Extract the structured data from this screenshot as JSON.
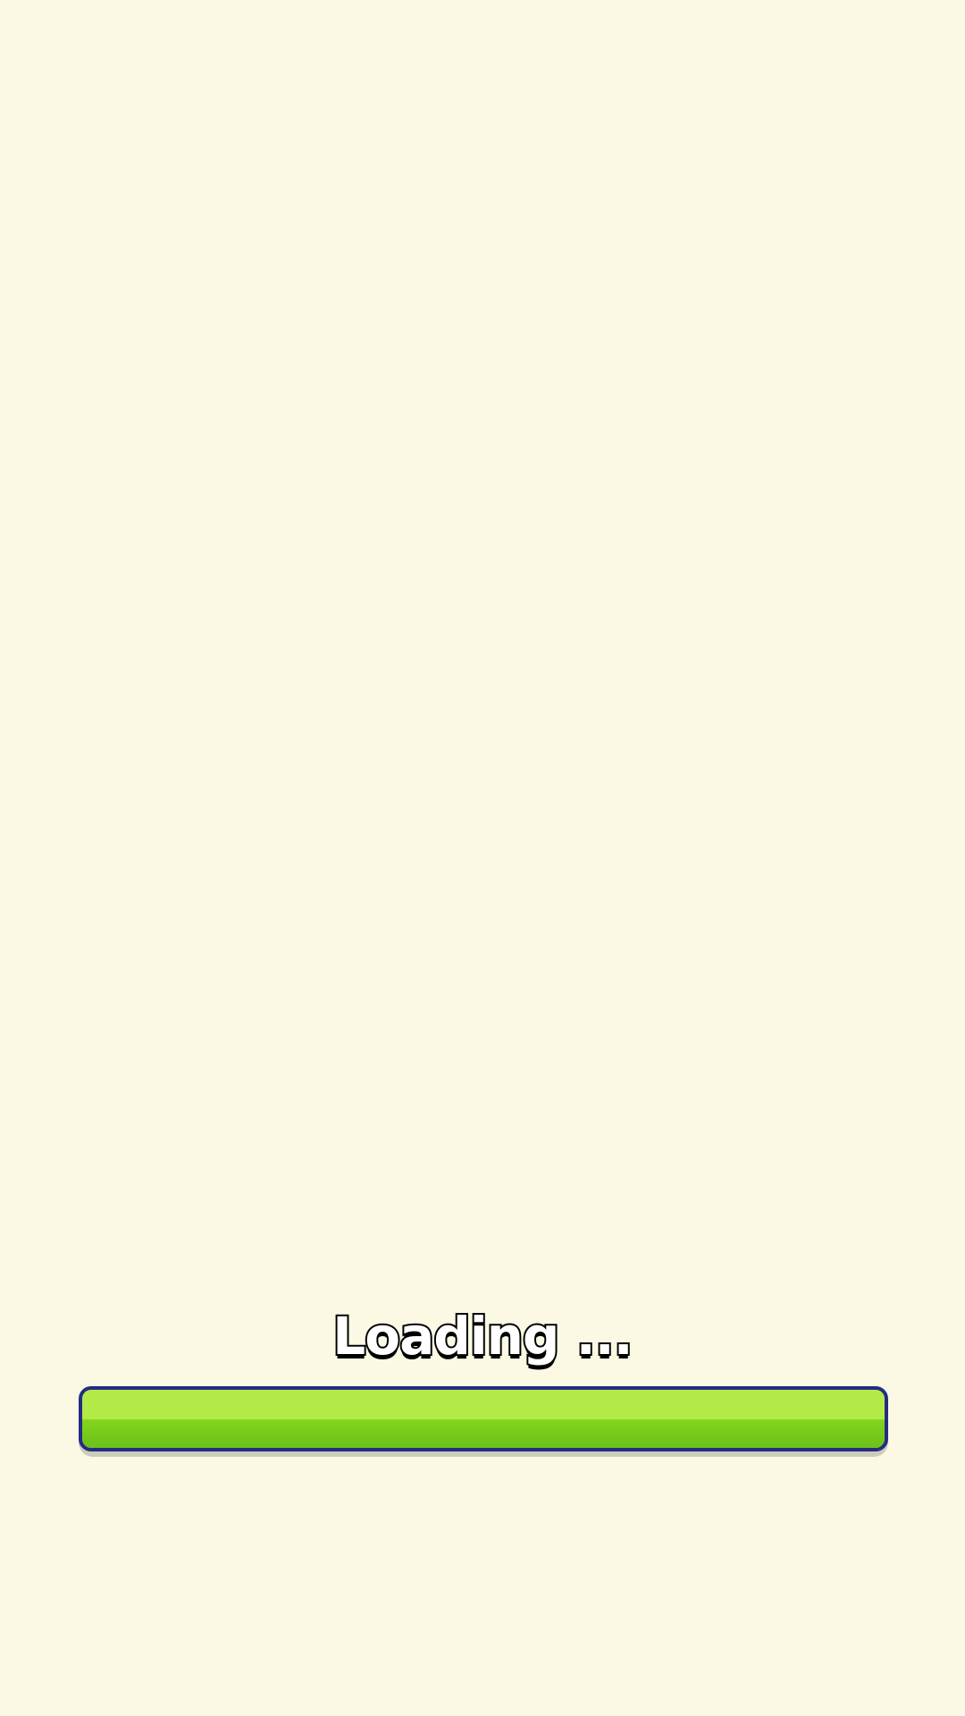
{
  "loading": {
    "label": "Loading ...",
    "progress_percent": 100
  },
  "colors": {
    "background": "#fbf9e3",
    "bar_border": "#252c84",
    "bar_fill_light": "#b4ea47",
    "bar_fill_dark": "#6cc11a",
    "text_fill": "#ffffff",
    "text_outline": "#000000"
  }
}
